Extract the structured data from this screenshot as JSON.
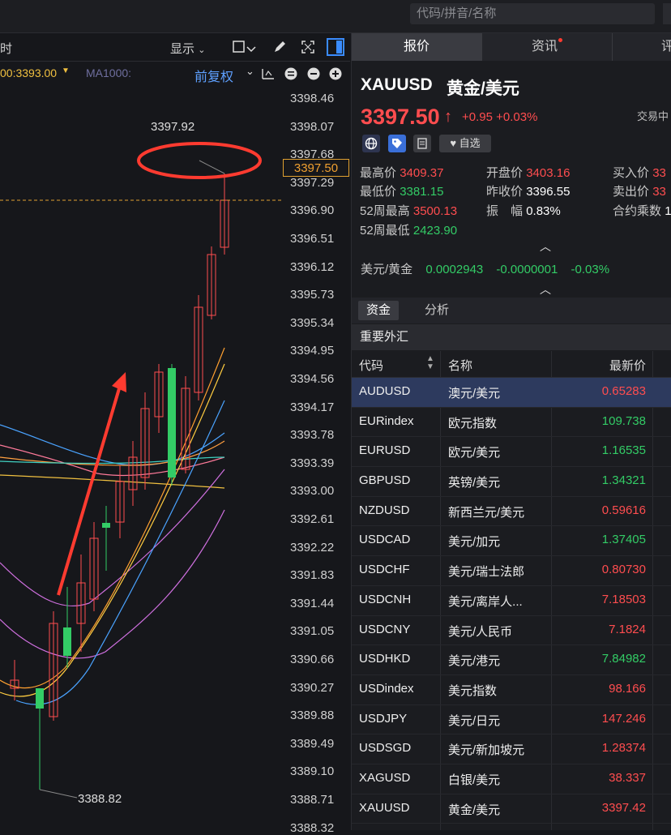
{
  "search": {
    "placeholder": "代码/拼音/名称"
  },
  "toolbar": {
    "left_fragment": "时",
    "display_label": "显示",
    "adjust_label": "前复权"
  },
  "legend": {
    "ma_value": "00:3393.00",
    "ma1000_label": "MA1000:"
  },
  "price_axis": [
    "3398.46",
    "3398.07",
    "3397.68",
    "3397.29",
    "3396.90",
    "3396.51",
    "3396.12",
    "3395.73",
    "3395.34",
    "3394.95",
    "3394.56",
    "3394.17",
    "3393.78",
    "3393.39",
    "3393.00",
    "3392.61",
    "3392.22",
    "3391.83",
    "3391.44",
    "3391.05",
    "3390.66",
    "3390.27",
    "3389.88",
    "3389.49",
    "3389.10",
    "3388.71",
    "3388.32"
  ],
  "chart": {
    "current_price_tag": "3397.50",
    "high_annotation": "3397.92",
    "low_annotation": "3388.82"
  },
  "tabs": [
    {
      "label": "报价"
    },
    {
      "label": "资讯"
    },
    {
      "label": "评"
    }
  ],
  "quote": {
    "symbol": "XAUUSD",
    "name": "黄金/美元",
    "last": "3397.50",
    "change": "+0.95",
    "change_pct": "+0.03%",
    "status": "交易中",
    "watchlist_label": "自选",
    "stats": {
      "high_label": "最高价",
      "high": "3409.37",
      "open_label": "开盘价",
      "open": "3403.16",
      "bid_label": "买入价",
      "bid": "33",
      "low_label": "最低价",
      "low": "3381.15",
      "prev_close_label": "昨收价",
      "prev_close": "3396.55",
      "ask_label": "卖出价",
      "ask": "33",
      "w52_high_label": "52周最高",
      "w52_high": "3500.13",
      "amplitude_label": "振　幅",
      "amplitude": "0.83%",
      "contract_label": "合约乘数",
      "contract": "1",
      "w52_low_label": "52周最低",
      "w52_low": "2423.90"
    },
    "fx": {
      "label": "美元/黄金",
      "value": "0.0002943",
      "change": "-0.0000001",
      "change_pct": "-0.03%"
    }
  },
  "subtabs": [
    {
      "label": "资金"
    },
    {
      "label": "分析"
    }
  ],
  "section_title": "重要外汇",
  "table": {
    "headers": {
      "code": "代码",
      "name": "名称",
      "price": "最新价"
    },
    "rows": [
      {
        "code": "AUDUSD",
        "name": "澳元/美元",
        "price": "0.65283",
        "dir": "up"
      },
      {
        "code": "EURindex",
        "name": "欧元指数",
        "price": "109.738",
        "dir": "down"
      },
      {
        "code": "EURUSD",
        "name": "欧元/美元",
        "price": "1.16535",
        "dir": "down"
      },
      {
        "code": "GBPUSD",
        "name": "英镑/美元",
        "price": "1.34321",
        "dir": "down"
      },
      {
        "code": "NZDUSD",
        "name": "新西兰元/美元",
        "price": "0.59616",
        "dir": "up"
      },
      {
        "code": "USDCAD",
        "name": "美元/加元",
        "price": "1.37405",
        "dir": "down"
      },
      {
        "code": "USDCHF",
        "name": "美元/瑞士法郎",
        "price": "0.80730",
        "dir": "up"
      },
      {
        "code": "USDCNH",
        "name": "美元/离岸人...",
        "price": "7.18503",
        "dir": "up"
      },
      {
        "code": "USDCNY",
        "name": "美元/人民币",
        "price": "7.1824",
        "dir": "up"
      },
      {
        "code": "USDHKD",
        "name": "美元/港元",
        "price": "7.84982",
        "dir": "down"
      },
      {
        "code": "USDindex",
        "name": "美元指数",
        "price": "98.166",
        "dir": "up"
      },
      {
        "code": "USDJPY",
        "name": "美元/日元",
        "price": "147.246",
        "dir": "up"
      },
      {
        "code": "USDSGD",
        "name": "美元/新加坡元",
        "price": "1.28374",
        "dir": "up"
      },
      {
        "code": "XAGUSD",
        "name": "白银/美元",
        "price": "38.337",
        "dir": "up"
      },
      {
        "code": "XAUUSD",
        "name": "黄金/美元",
        "price": "3397.42",
        "dir": "up"
      }
    ]
  },
  "colors": {
    "up": "#ff4d4f",
    "down": "#33cc66",
    "selected_row": "#2d3a5e"
  }
}
